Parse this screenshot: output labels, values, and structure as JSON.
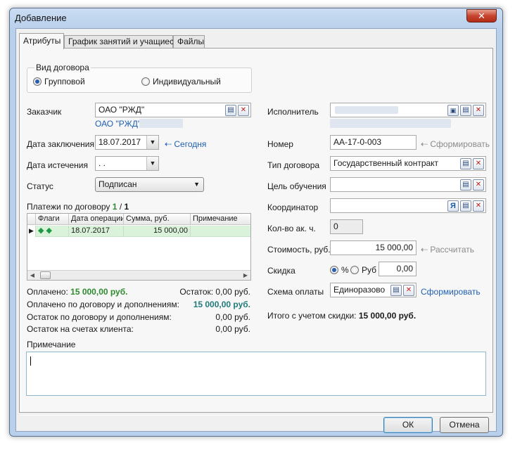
{
  "window": {
    "title": "Добавление",
    "close_glyph": "✕"
  },
  "tabs": [
    {
      "label": "Атрибуты"
    },
    {
      "label": "График занятий и учащиеся"
    },
    {
      "label": "Файлы"
    }
  ],
  "contract_kind": {
    "title": "Вид договора",
    "options": [
      "Групповой",
      "Индивидуальный"
    ],
    "selected": "Групповой"
  },
  "left": {
    "customer_label": "Заказчик",
    "customer_value": "ОАО \"РЖД\"",
    "customer_link": "ОАО \"РЖД\"/",
    "conclusion_date_label": "Дата заключения",
    "conclusion_date_value": "18.07.2017",
    "today_link": "⇠ Сегодня",
    "expiry_date_label": "Дата истечения",
    "expiry_date_value": " .  .",
    "status_label": "Статус",
    "status_value": "Подписан",
    "payments_label": "Платежи по договору",
    "payments_paid": "1",
    "payments_sep": "/",
    "payments_total": "1"
  },
  "payments_grid": {
    "columns": [
      "Флаги",
      "Дата операции",
      "Сумма, руб.",
      "Примечание"
    ],
    "rows": [
      {
        "flags": "◆ ◆",
        "date": "18.07.2017",
        "amount": "15 000,00",
        "note": ""
      }
    ]
  },
  "summary": {
    "paid_label": "Оплачено:",
    "paid_value": "15 000,00 руб.",
    "rest_label": "Остаток: 0,00 руб.",
    "paid_total_label": "Оплачено по договору и дополнениям:",
    "paid_total_value": "15 000,00 руб.",
    "rest_total_label": "Остаток по договору и дополнениям:",
    "rest_total_value": "0,00 руб.",
    "client_rest_label": "Остаток на счетах клиента:",
    "client_rest_value": "0,00 руб."
  },
  "right": {
    "executor_label": "Исполнитель",
    "number_label": "Номер",
    "number_value": "АА-17-0-003",
    "generate_link": "⇠ Сформировать",
    "contract_type_label": "Тип договора",
    "contract_type_value": "Государственный контракт",
    "goal_label": "Цель обучения",
    "coordinator_label": "Координатор",
    "hours_label": "Кол-во ак. ч.",
    "hours_value": "0",
    "cost_label": "Стоимость, руб.",
    "cost_value": "15 000,00",
    "calc_link": "⇠ Рассчитать",
    "discount_label": "Скидка",
    "discount_opt_percent": "%",
    "discount_opt_rub": "Руб",
    "discount_value": "0,00",
    "pay_scheme_label": "Схема оплаты",
    "pay_scheme_value": "Единоразово",
    "form_link": "Сформировать",
    "total_label": "Итого с учетом скидки:",
    "total_value": "15 000,00 руб."
  },
  "note": {
    "label": "Примечание",
    "value": ""
  },
  "buttons": {
    "ok": "ОК",
    "cancel": "Отмена"
  },
  "icons": {
    "pick": "▤",
    "delete": "✕",
    "mail": "Я",
    "lock": "▣",
    "arrow_down": "▼",
    "row_pointer": "▶",
    "scroll_left": "◀",
    "scroll_right": "▶"
  }
}
